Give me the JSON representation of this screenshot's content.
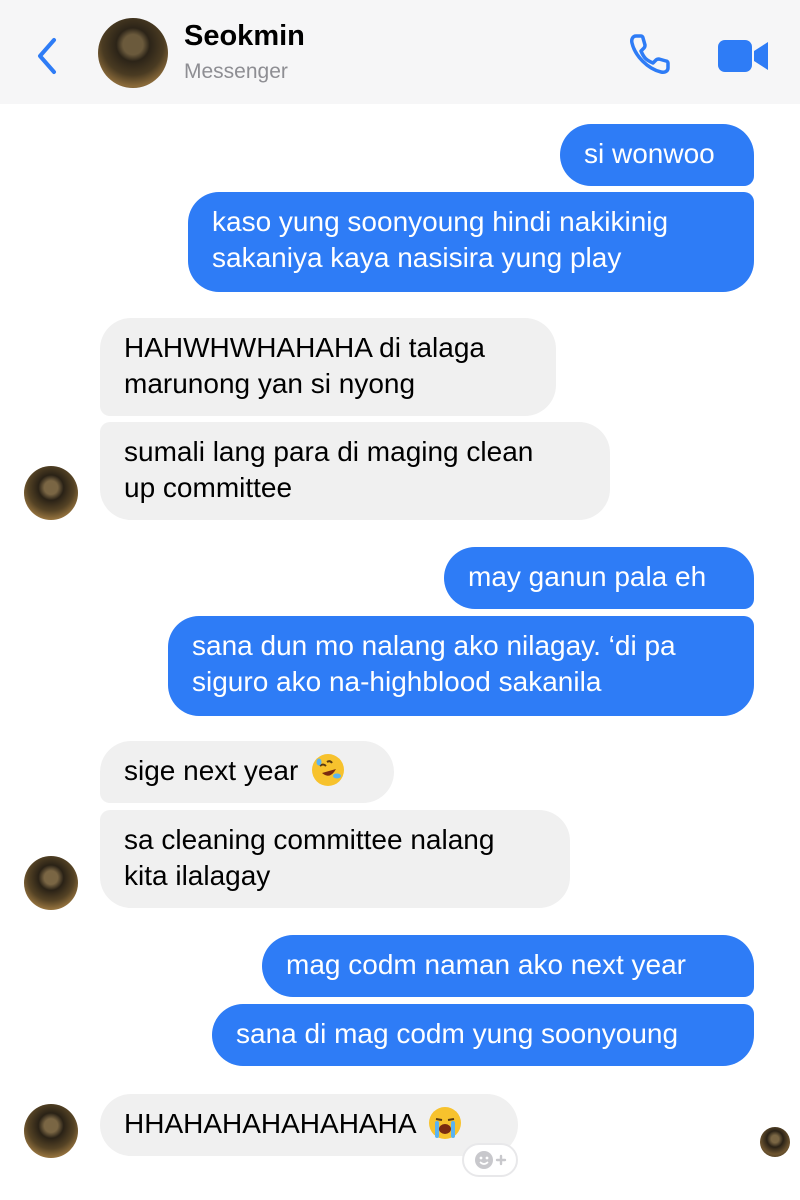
{
  "header": {
    "contact_name": "Seokmin",
    "contact_subtitle": "Messenger",
    "back_icon": "chevron-left-icon",
    "call_icon": "phone-icon",
    "video_icon": "video-camera-icon",
    "accent_color": "#2e7cf6"
  },
  "messages": [
    {
      "side": "outgoing",
      "text": "si wonwoo"
    },
    {
      "side": "outgoing",
      "lines": [
        "kaso yung soonyoung hindi nakikinig",
        "sakaniya kaya nasisira yung play"
      ]
    },
    {
      "side": "incoming",
      "lines": [
        "HAHWHWHAHAHA di talaga",
        "marunong yan si nyong"
      ]
    },
    {
      "side": "incoming",
      "lines": [
        "sumali lang para di maging clean",
        "up committee"
      ]
    },
    {
      "side": "outgoing",
      "text": "may ganun pala eh"
    },
    {
      "side": "outgoing",
      "lines": [
        "sana dun mo nalang ako nilagay. ‘di pa",
        "siguro ako na-highblood sakanila"
      ]
    },
    {
      "side": "incoming",
      "text": "sige next year",
      "emoji": "rolling-on-floor-laughing-emoji"
    },
    {
      "side": "incoming",
      "lines": [
        "sa cleaning committee nalang",
        "kita ilalagay"
      ]
    },
    {
      "side": "outgoing",
      "text": "mag codm naman ako next year"
    },
    {
      "side": "outgoing",
      "text": "sana di mag codm yung soonyoung"
    },
    {
      "side": "incoming",
      "text": "HHAHAHAHAHAHAHA",
      "emoji": "loudly-crying-emoji"
    }
  ],
  "reaction_button_icon": "add-reaction-icon",
  "colors": {
    "outgoing_bubble": "#2e7cf6",
    "incoming_bubble": "#f0f0f0",
    "header_background": "#f6f6f7"
  }
}
